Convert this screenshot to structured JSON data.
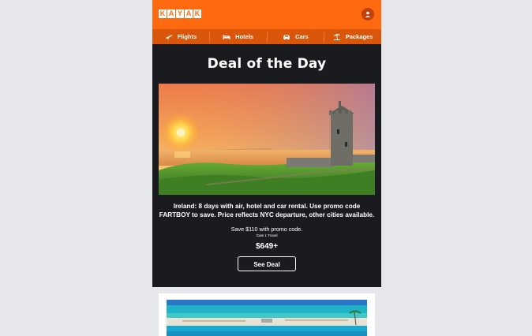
{
  "brand": {
    "letters": [
      "K",
      "A",
      "Y",
      "A",
      "K"
    ],
    "color": "#ff690f"
  },
  "nav": [
    {
      "label": "Flights",
      "icon": "plane-icon"
    },
    {
      "label": "Hotels",
      "icon": "bed-icon"
    },
    {
      "label": "Cars",
      "icon": "car-icon"
    },
    {
      "label": "Packages",
      "icon": "beach-umbrella-icon"
    }
  ],
  "deal": {
    "title": "Deal of the Day",
    "description": "Ireland: 8 days with air, hotel and car rental. Use promo code FARTBOY to save. Price reflects NYC departure, other cities available.",
    "save_text": "Save $110 with promo code.",
    "provider": "Gate 1 Travel",
    "price": "$649+",
    "cta_label": "See Deal"
  }
}
